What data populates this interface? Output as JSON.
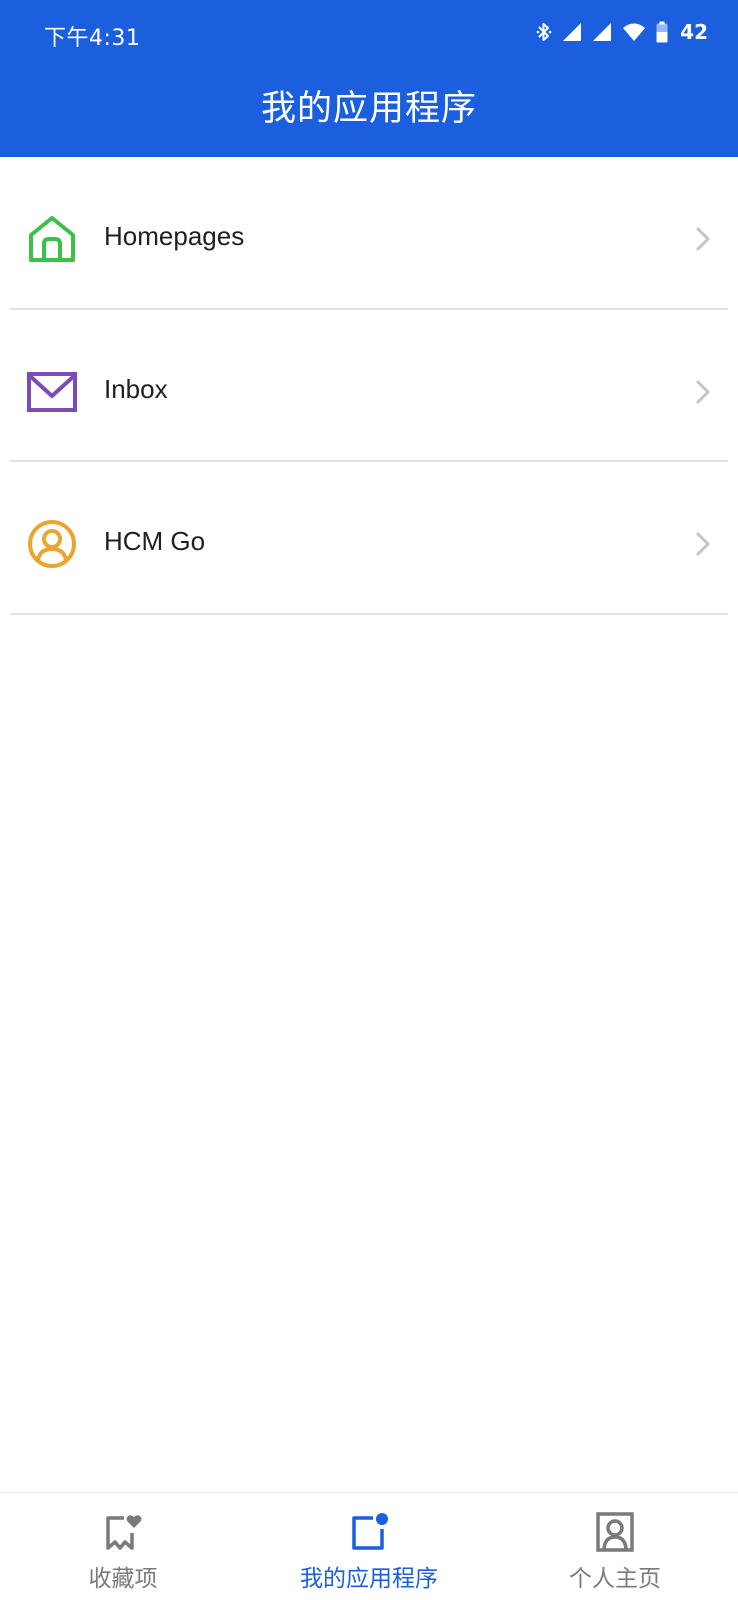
{
  "status_bar": {
    "time": "下午4:31",
    "battery": "42",
    "icons": [
      "bluetooth-icon",
      "signal-icon",
      "signal-icon",
      "wifi-icon",
      "battery-icon"
    ]
  },
  "header": {
    "title": "我的应用程序",
    "background_color": "#1b5fdf"
  },
  "apps": [
    {
      "label": "Homepages",
      "icon": "home-icon",
      "color": "#3cc04a"
    },
    {
      "label": "Inbox",
      "icon": "mail-icon",
      "color": "#7d4bb5"
    },
    {
      "label": "HCM Go",
      "icon": "user-circle-icon",
      "color": "#e9a431"
    }
  ],
  "tabbar": {
    "tabs": [
      {
        "label": "收藏项",
        "icon": "favorites-icon",
        "active": false
      },
      {
        "label": "我的应用程序",
        "icon": "my-apps-icon",
        "active": true
      },
      {
        "label": "个人主页",
        "icon": "profile-icon",
        "active": false
      }
    ],
    "active_color": "#1b5fdf",
    "inactive_color": "#7a7a7a"
  }
}
